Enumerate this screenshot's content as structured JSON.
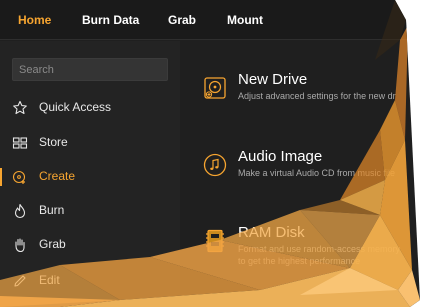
{
  "top_tabs": [
    {
      "label": "Home"
    },
    {
      "label": "Burn Data"
    },
    {
      "label": "Grab"
    },
    {
      "label": "Mount"
    }
  ],
  "search": {
    "placeholder": "Search"
  },
  "sidebar": {
    "items": [
      {
        "label": "Quick Access",
        "icon": "star-icon"
      },
      {
        "label": "Store",
        "icon": "grid-icon"
      },
      {
        "label": "Create",
        "icon": "create-disc-icon"
      },
      {
        "label": "Burn",
        "icon": "burn-icon"
      },
      {
        "label": "Grab",
        "icon": "hand-icon"
      },
      {
        "label": "Edit",
        "icon": "pencil-icon"
      }
    ]
  },
  "features": [
    {
      "title": "New Drive",
      "description": "Adjust advanced settings for the new dr",
      "icon": "drive-icon"
    },
    {
      "title": "Audio Image",
      "description": "Make a virtual Audio CD from music file",
      "icon": "music-disc-icon"
    },
    {
      "title": "RAM Disk",
      "description": "Format and use random-access memory",
      "description2": "to get the highest performance",
      "icon": "ram-icon"
    }
  ],
  "colors": {
    "accent": "#f7a530",
    "background": "#1f1f1f",
    "sidebar": "#232323"
  }
}
